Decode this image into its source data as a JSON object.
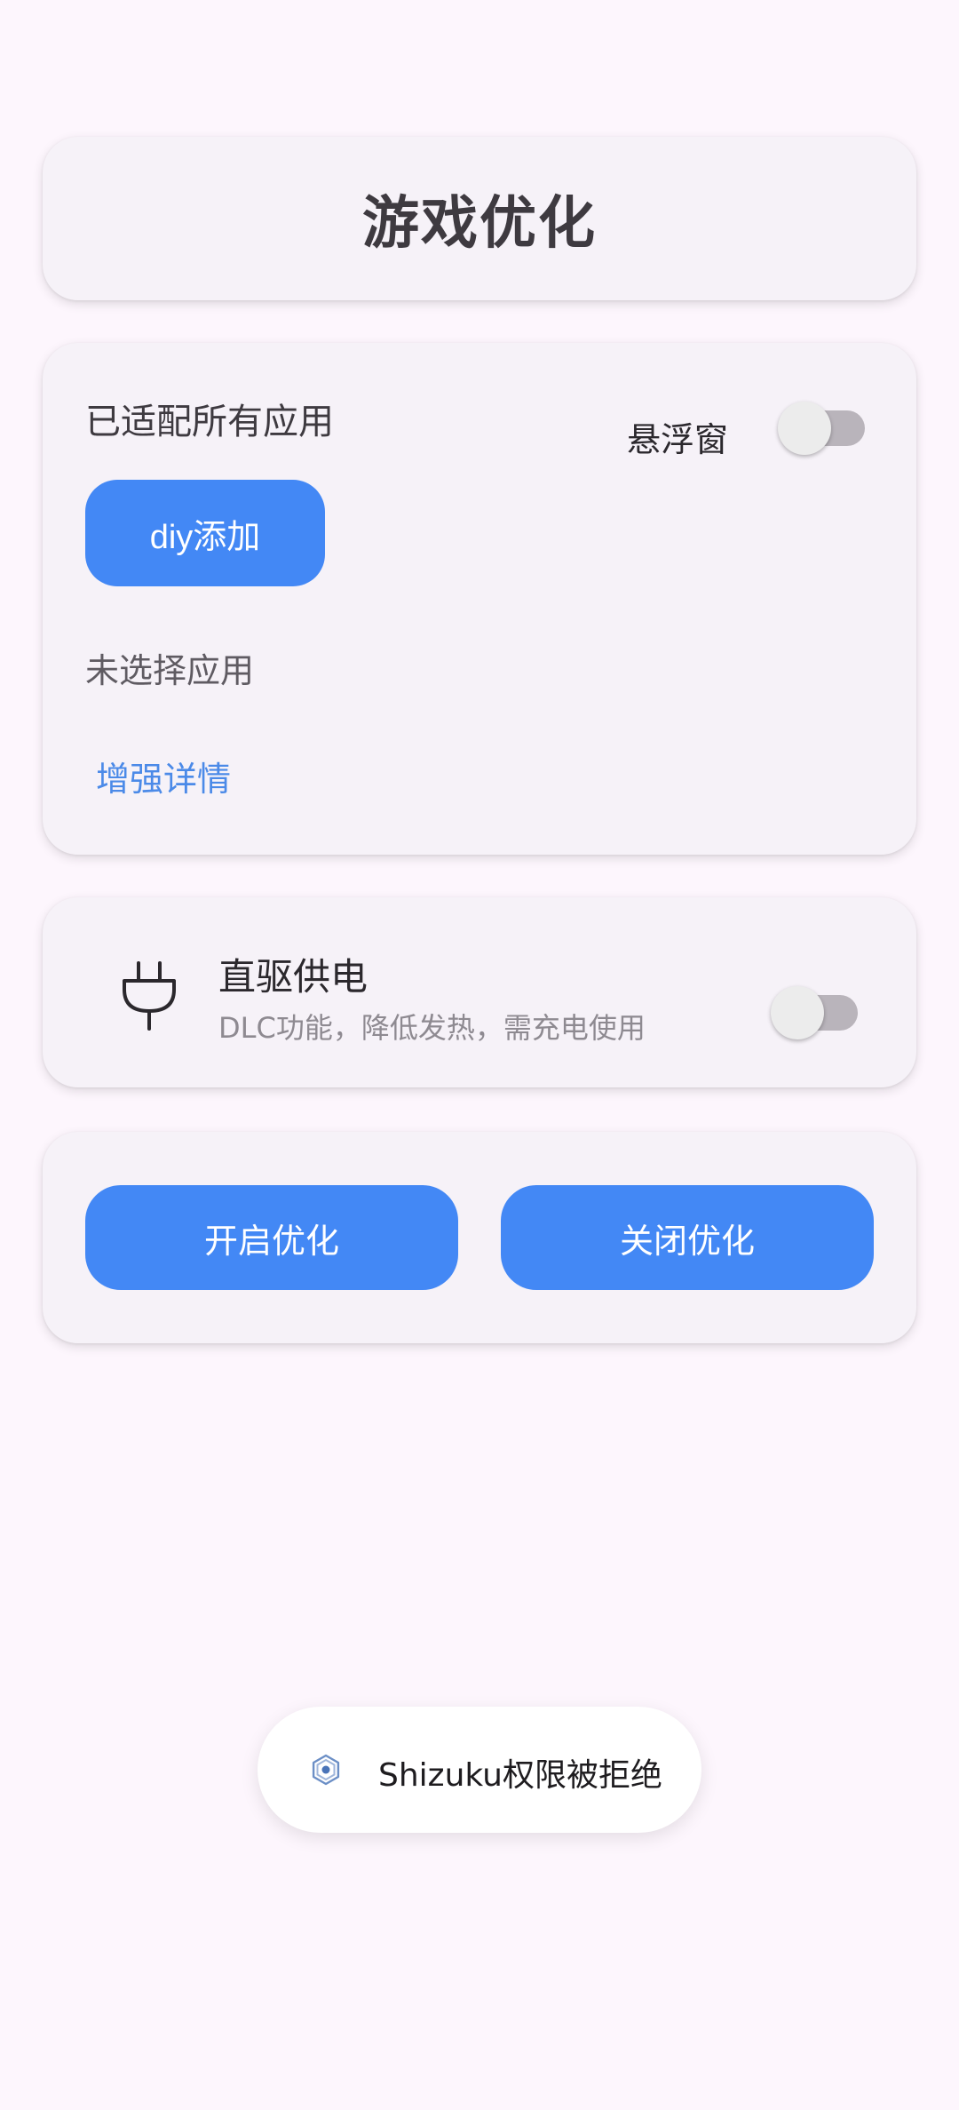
{
  "header": {
    "title": "游戏优化"
  },
  "app_card": {
    "status_text": "已适配所有应用",
    "float_window_label": "悬浮窗",
    "float_window_enabled": false,
    "diy_button_label": "diy添加",
    "selected_app_text": "未选择应用",
    "enhance_link_label": "增强详情"
  },
  "power_card": {
    "icon": "plug-icon",
    "title": "直驱供电",
    "description": "DLC功能，降低发热，需充电使用",
    "enabled": false
  },
  "actions": {
    "open_label": "开启优化",
    "close_label": "关闭优化"
  },
  "toast": {
    "icon": "shizuku-icon",
    "message": "Shizuku权限被拒绝"
  },
  "colors": {
    "background": "#fdf6fd",
    "card": "#f6f2f8",
    "accent": "#4388f5",
    "link": "#4b8ae8"
  }
}
